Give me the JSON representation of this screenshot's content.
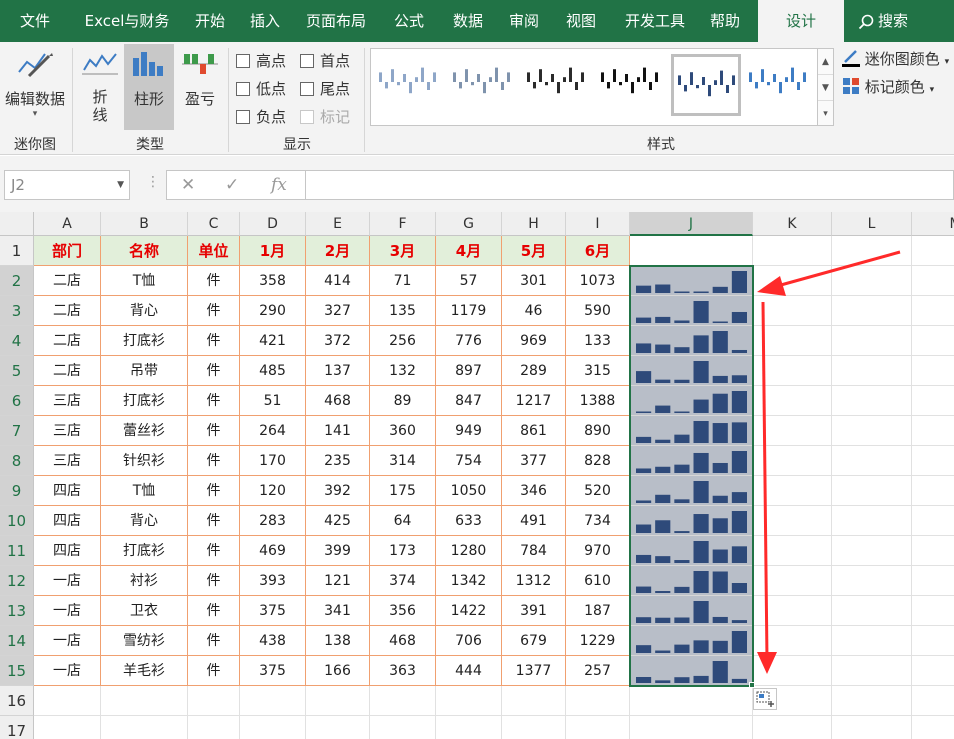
{
  "tabs": [
    "文件",
    "Excel与财务",
    "开始",
    "插入",
    "页面布局",
    "公式",
    "数据",
    "审阅",
    "视图",
    "开发工具",
    "帮助",
    "设计"
  ],
  "active_tab": "设计",
  "search_label": "搜索",
  "ribbon": {
    "sparkline_group": {
      "edit_data_label": "编辑数据",
      "group_label": "迷你图"
    },
    "type_group": {
      "line_label": "折\n线",
      "column_label": "柱形",
      "winloss_label": "盈亏",
      "group_label": "类型"
    },
    "show_group": {
      "high_point": "高点",
      "first_point": "首点",
      "low_point": "低点",
      "last_point": "尾点",
      "negative_point": "负点",
      "markers": "标记",
      "group_label": "显示"
    },
    "style_group": {
      "group_label": "样式"
    },
    "sparkline_color_label": "迷你图颜色",
    "marker_color_label": "标记颜色"
  },
  "formula_bar": {
    "name_box": "J2",
    "formula": ""
  },
  "columns": [
    "A",
    "B",
    "C",
    "D",
    "E",
    "F",
    "G",
    "H",
    "I",
    "J",
    "K",
    "L",
    "M"
  ],
  "selected_column": "J",
  "row_numbers": [
    "1",
    "2",
    "3",
    "4",
    "5",
    "6",
    "7",
    "8",
    "9",
    "10",
    "11",
    "12",
    "13",
    "14",
    "15",
    "16",
    "17"
  ],
  "table": {
    "headers": [
      "部门",
      "名称",
      "单位",
      "1月",
      "2月",
      "3月",
      "4月",
      "5月",
      "6月"
    ],
    "rows": [
      [
        "二店",
        "T恤",
        "件",
        358,
        414,
        71,
        57,
        301,
        1073
      ],
      [
        "二店",
        "背心",
        "件",
        290,
        327,
        135,
        1179,
        46,
        590
      ],
      [
        "二店",
        "打底衫",
        "件",
        421,
        372,
        256,
        776,
        969,
        133
      ],
      [
        "二店",
        "吊带",
        "件",
        485,
        137,
        132,
        897,
        289,
        315
      ],
      [
        "三店",
        "打底衫",
        "件",
        51,
        468,
        89,
        847,
        1217,
        1388
      ],
      [
        "三店",
        "蕾丝衫",
        "件",
        264,
        141,
        360,
        949,
        861,
        890
      ],
      [
        "三店",
        "针织衫",
        "件",
        170,
        235,
        314,
        754,
        377,
        828
      ],
      [
        "四店",
        "T恤",
        "件",
        120,
        392,
        175,
        1050,
        346,
        520
      ],
      [
        "四店",
        "背心",
        "件",
        283,
        425,
        64,
        633,
        491,
        734
      ],
      [
        "四店",
        "打底衫",
        "件",
        469,
        399,
        173,
        1280,
        784,
        970
      ],
      [
        "一店",
        "衬衫",
        "件",
        393,
        121,
        374,
        1342,
        1312,
        610
      ],
      [
        "一店",
        "卫衣",
        "件",
        375,
        341,
        356,
        1422,
        391,
        187
      ],
      [
        "一店",
        "雪纺衫",
        "件",
        438,
        138,
        468,
        706,
        679,
        1229
      ],
      [
        "一店",
        "羊毛衫",
        "件",
        375,
        166,
        363,
        444,
        1377,
        257
      ]
    ]
  },
  "colors": {
    "ribbon_green": "#217346",
    "sparkline_bar": "#2e4a7a",
    "sparkline_bg": "#b8bec8",
    "header_fill": "#e2efda",
    "header_text": "#e60000",
    "arrow": "#ff2a2a"
  }
}
